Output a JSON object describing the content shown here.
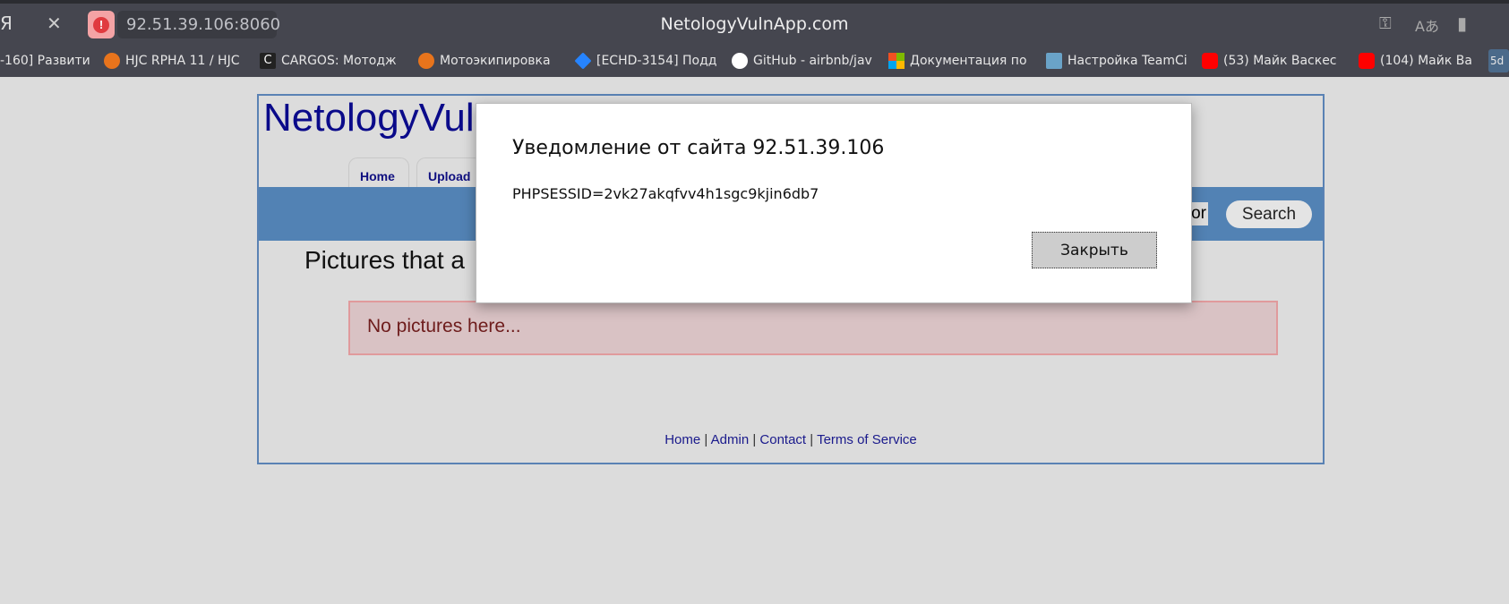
{
  "browser": {
    "address": "92.51.39.106:8060",
    "window_title": "NetologyVulnApp.com",
    "bookmarks": [
      {
        "label": "-160] Развити",
        "icon": "page-icon"
      },
      {
        "label": "HJC RPHA 11 / HJC",
        "icon": "moto-icon",
        "color": "#e8741c"
      },
      {
        "label": "CARGOS: Мотодж",
        "icon": "c-logo-icon",
        "color": "#222222"
      },
      {
        "label": "Мотоэкипировка",
        "icon": "moto-icon",
        "color": "#e8741c"
      },
      {
        "label": "[ECHD-3154] Подд",
        "icon": "jira-icon",
        "color": "#2684ff"
      },
      {
        "label": "GitHub - airbnb/jav",
        "icon": "github-icon",
        "color": "#ffffff"
      },
      {
        "label": "Документация по",
        "icon": "microsoft-icon"
      },
      {
        "label": "Настройка TeamCi",
        "icon": "teamcity-icon",
        "color": "#6aa3c8"
      },
      {
        "label": "(53) Майк Васкес",
        "icon": "youtube-icon",
        "color": "#ff0000"
      },
      {
        "label": "(104) Майк Ва",
        "icon": "youtube-icon",
        "color": "#ff0000"
      },
      {
        "label": "5d",
        "icon": "5d-icon",
        "color": "#4b6a8a"
      }
    ]
  },
  "site": {
    "logo": "NetologyVulnApp",
    "tabs": [
      {
        "label": "Home"
      },
      {
        "label": "Upload"
      }
    ],
    "search_value": "or",
    "search_button": "Search",
    "heading": "Pictures that a",
    "empty_message": "No pictures here...",
    "footer": {
      "links": [
        "Home",
        "Admin",
        "Contact",
        "Terms of Service"
      ],
      "separator": " | "
    }
  },
  "dialog": {
    "title": "Уведомление от сайта 92.51.39.106",
    "message": "PHPSESSID=2vk27akqfvv4h1sgc9kjin6db7",
    "close_label": "Закрыть"
  }
}
